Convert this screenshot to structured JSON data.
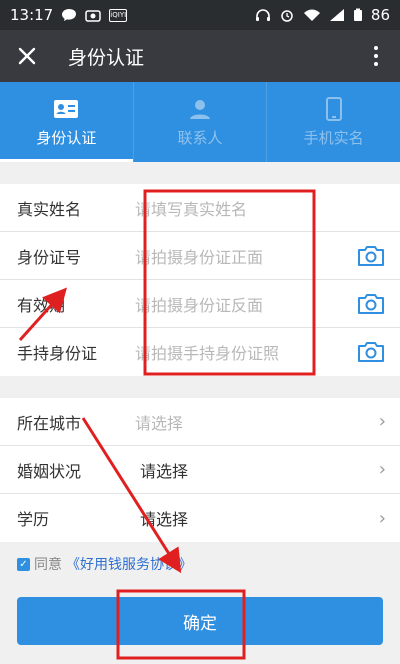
{
  "status_bar": {
    "time": "13:17",
    "battery": "86",
    "icons": [
      "chat-icon",
      "camera-icon",
      "qiyi-icon",
      "headphone-icon",
      "alarm-icon",
      "wifi-icon",
      "signal-icon",
      "battery-icon"
    ]
  },
  "nav": {
    "title": "身份认证",
    "close_icon": "close-icon",
    "more_icon": "more-vertical-icon"
  },
  "tabs": [
    {
      "label": "身份认证",
      "icon": "id-card-icon",
      "active": true
    },
    {
      "label": "联系人",
      "icon": "person-icon",
      "active": false
    },
    {
      "label": "手机实名",
      "icon": "phone-icon",
      "active": false
    }
  ],
  "identity_rows": [
    {
      "label": "真实姓名",
      "placeholder": "请填写真实姓名"
    },
    {
      "label": "身份证号",
      "placeholder": "请拍摄身份证正面",
      "icon": "camera-icon"
    },
    {
      "label": "有效期",
      "placeholder": "请拍摄身份证反面",
      "icon": "camera-icon"
    },
    {
      "label": "手持身份证",
      "placeholder": "请拍摄手持身份证照",
      "icon": "camera-icon"
    }
  ],
  "info_rows": [
    {
      "label": "所在城市",
      "value": "请选择"
    },
    {
      "label": "婚姻状况",
      "value": "请选择"
    },
    {
      "label": "学历",
      "value": "请选择"
    }
  ],
  "agreement": {
    "prefix": "同意",
    "link": "《好用钱服务协议》",
    "checked": true
  },
  "confirm_label": "确定",
  "colors": {
    "accent": "#2f8fe0",
    "annotation": "#e02020"
  }
}
